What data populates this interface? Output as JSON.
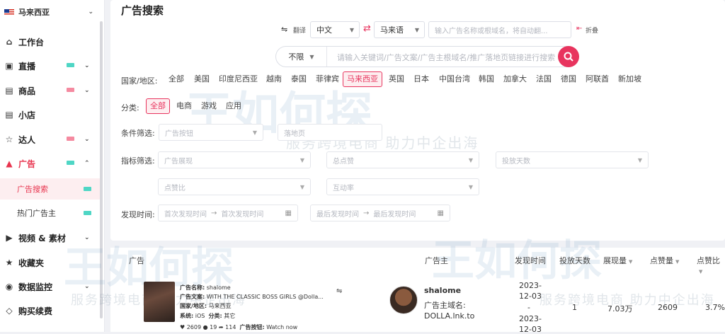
{
  "sidebar": {
    "country": "马来西亚",
    "items": [
      {
        "label": "工作台",
        "icon": "home-icon"
      },
      {
        "label": "直播",
        "icon": "live-icon",
        "tag": "#4fd6c5"
      },
      {
        "label": "商品",
        "icon": "goods-icon",
        "tag": "#f58aa0"
      },
      {
        "label": "小店",
        "icon": "shop-icon"
      },
      {
        "label": "达人",
        "icon": "star-icon",
        "tag": "#f58aa0"
      },
      {
        "label": "广告",
        "icon": "ad-icon",
        "tag": "#4fd6c5"
      },
      {
        "label": "视频 & 素材",
        "icon": "video-icon"
      },
      {
        "label": "收藏夹",
        "icon": "favorite-icon"
      },
      {
        "label": "数据监控",
        "icon": "monitor-icon"
      },
      {
        "label": "购买续费",
        "icon": "purchase-icon"
      }
    ],
    "sub_items": [
      "广告搜索",
      "热门广告主"
    ]
  },
  "page": {
    "title": "广告搜索"
  },
  "translate": {
    "label": "翻译",
    "from": "中文",
    "to": "马来语",
    "placeholder": "输入广告名称或根域名，将自动翻...",
    "fold": "折叠"
  },
  "search": {
    "limit": "不限",
    "placeholder": "请输入关键词/广告文案/广告主根域名/推广落地页链接进行搜索"
  },
  "filters": {
    "region_label": "国家/地区:",
    "regions": [
      "全部",
      "美国",
      "印度尼西亚",
      "越南",
      "泰国",
      "菲律宾",
      "马来西亚",
      "英国",
      "日本",
      "中国台湾",
      "韩国",
      "加拿大",
      "法国",
      "德国",
      "阿联酋",
      "新加坡"
    ],
    "region_selected": "马来西亚",
    "category_label": "分类:",
    "categories": [
      "全部",
      "电商",
      "游戏",
      "应用"
    ],
    "category_selected": "全部",
    "condition_label": "条件筛选:",
    "condition_inputs": [
      "广告按钮",
      "落地页"
    ],
    "metric_label": "指标筛选:",
    "metric_inputs": [
      "广告展现",
      "总点赞",
      "投放天数",
      "点赞比",
      "互动率"
    ],
    "time_label": "发现时间:",
    "first_start": "首次发现时间",
    "first_end": "首次发现时间",
    "last_start": "最后发现时间",
    "last_end": "最后发现时间"
  },
  "table": {
    "headers": [
      "广告",
      "广告主",
      "发现时间",
      "投放天数",
      "展现量",
      "点赞量",
      "点赞比"
    ],
    "row": {
      "ad_name_label": "广告名称:",
      "ad_name": "shalome",
      "ad_copy_label": "广告文案:",
      "ad_copy": "WITH THE CLASSIC BOSS GIRLS @Dolla...",
      "region_label": "国家/地区:",
      "region": "马来西亚",
      "system_label": "系统:",
      "system": "iOS",
      "category_label": "分类:",
      "category": "其它",
      "likes": "2609",
      "comments": "19",
      "shares": "114",
      "button_label": "广告按钮:",
      "button": "Watch now",
      "advertiser": "shalome",
      "domain_label": "广告主域名:",
      "domain": "DOLLA.lnk.to",
      "date_line1": "2023-",
      "date_line2": "12-03",
      "date_sep": "-",
      "date_line3": "2023-",
      "date_line4": "12-03",
      "days": "1",
      "impressions": "7.03万",
      "like_count": "2609",
      "like_ratio": "3.7%"
    }
  },
  "watermark": {
    "text": "王如何探",
    "slogan": "服务跨境电商  助力中企出海"
  },
  "colors": {
    "accent": "#e8345e",
    "active_bg": "#fdeef0"
  }
}
